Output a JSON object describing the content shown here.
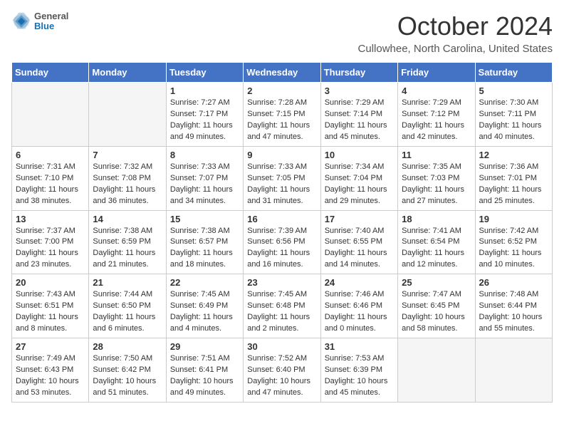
{
  "header": {
    "logo_general": "General",
    "logo_blue": "Blue",
    "title": "October 2024",
    "location": "Cullowhee, North Carolina, United States"
  },
  "days_of_week": [
    "Sunday",
    "Monday",
    "Tuesday",
    "Wednesday",
    "Thursday",
    "Friday",
    "Saturday"
  ],
  "weeks": [
    [
      {
        "day": "",
        "sunrise": "",
        "sunset": "",
        "daylight": ""
      },
      {
        "day": "",
        "sunrise": "",
        "sunset": "",
        "daylight": ""
      },
      {
        "day": "1",
        "sunrise": "Sunrise: 7:27 AM",
        "sunset": "Sunset: 7:17 PM",
        "daylight": "Daylight: 11 hours and 49 minutes."
      },
      {
        "day": "2",
        "sunrise": "Sunrise: 7:28 AM",
        "sunset": "Sunset: 7:15 PM",
        "daylight": "Daylight: 11 hours and 47 minutes."
      },
      {
        "day": "3",
        "sunrise": "Sunrise: 7:29 AM",
        "sunset": "Sunset: 7:14 PM",
        "daylight": "Daylight: 11 hours and 45 minutes."
      },
      {
        "day": "4",
        "sunrise": "Sunrise: 7:29 AM",
        "sunset": "Sunset: 7:12 PM",
        "daylight": "Daylight: 11 hours and 42 minutes."
      },
      {
        "day": "5",
        "sunrise": "Sunrise: 7:30 AM",
        "sunset": "Sunset: 7:11 PM",
        "daylight": "Daylight: 11 hours and 40 minutes."
      }
    ],
    [
      {
        "day": "6",
        "sunrise": "Sunrise: 7:31 AM",
        "sunset": "Sunset: 7:10 PM",
        "daylight": "Daylight: 11 hours and 38 minutes."
      },
      {
        "day": "7",
        "sunrise": "Sunrise: 7:32 AM",
        "sunset": "Sunset: 7:08 PM",
        "daylight": "Daylight: 11 hours and 36 minutes."
      },
      {
        "day": "8",
        "sunrise": "Sunrise: 7:33 AM",
        "sunset": "Sunset: 7:07 PM",
        "daylight": "Daylight: 11 hours and 34 minutes."
      },
      {
        "day": "9",
        "sunrise": "Sunrise: 7:33 AM",
        "sunset": "Sunset: 7:05 PM",
        "daylight": "Daylight: 11 hours and 31 minutes."
      },
      {
        "day": "10",
        "sunrise": "Sunrise: 7:34 AM",
        "sunset": "Sunset: 7:04 PM",
        "daylight": "Daylight: 11 hours and 29 minutes."
      },
      {
        "day": "11",
        "sunrise": "Sunrise: 7:35 AM",
        "sunset": "Sunset: 7:03 PM",
        "daylight": "Daylight: 11 hours and 27 minutes."
      },
      {
        "day": "12",
        "sunrise": "Sunrise: 7:36 AM",
        "sunset": "Sunset: 7:01 PM",
        "daylight": "Daylight: 11 hours and 25 minutes."
      }
    ],
    [
      {
        "day": "13",
        "sunrise": "Sunrise: 7:37 AM",
        "sunset": "Sunset: 7:00 PM",
        "daylight": "Daylight: 11 hours and 23 minutes."
      },
      {
        "day": "14",
        "sunrise": "Sunrise: 7:38 AM",
        "sunset": "Sunset: 6:59 PM",
        "daylight": "Daylight: 11 hours and 21 minutes."
      },
      {
        "day": "15",
        "sunrise": "Sunrise: 7:38 AM",
        "sunset": "Sunset: 6:57 PM",
        "daylight": "Daylight: 11 hours and 18 minutes."
      },
      {
        "day": "16",
        "sunrise": "Sunrise: 7:39 AM",
        "sunset": "Sunset: 6:56 PM",
        "daylight": "Daylight: 11 hours and 16 minutes."
      },
      {
        "day": "17",
        "sunrise": "Sunrise: 7:40 AM",
        "sunset": "Sunset: 6:55 PM",
        "daylight": "Daylight: 11 hours and 14 minutes."
      },
      {
        "day": "18",
        "sunrise": "Sunrise: 7:41 AM",
        "sunset": "Sunset: 6:54 PM",
        "daylight": "Daylight: 11 hours and 12 minutes."
      },
      {
        "day": "19",
        "sunrise": "Sunrise: 7:42 AM",
        "sunset": "Sunset: 6:52 PM",
        "daylight": "Daylight: 11 hours and 10 minutes."
      }
    ],
    [
      {
        "day": "20",
        "sunrise": "Sunrise: 7:43 AM",
        "sunset": "Sunset: 6:51 PM",
        "daylight": "Daylight: 11 hours and 8 minutes."
      },
      {
        "day": "21",
        "sunrise": "Sunrise: 7:44 AM",
        "sunset": "Sunset: 6:50 PM",
        "daylight": "Daylight: 11 hours and 6 minutes."
      },
      {
        "day": "22",
        "sunrise": "Sunrise: 7:45 AM",
        "sunset": "Sunset: 6:49 PM",
        "daylight": "Daylight: 11 hours and 4 minutes."
      },
      {
        "day": "23",
        "sunrise": "Sunrise: 7:45 AM",
        "sunset": "Sunset: 6:48 PM",
        "daylight": "Daylight: 11 hours and 2 minutes."
      },
      {
        "day": "24",
        "sunrise": "Sunrise: 7:46 AM",
        "sunset": "Sunset: 6:46 PM",
        "daylight": "Daylight: 11 hours and 0 minutes."
      },
      {
        "day": "25",
        "sunrise": "Sunrise: 7:47 AM",
        "sunset": "Sunset: 6:45 PM",
        "daylight": "Daylight: 10 hours and 58 minutes."
      },
      {
        "day": "26",
        "sunrise": "Sunrise: 7:48 AM",
        "sunset": "Sunset: 6:44 PM",
        "daylight": "Daylight: 10 hours and 55 minutes."
      }
    ],
    [
      {
        "day": "27",
        "sunrise": "Sunrise: 7:49 AM",
        "sunset": "Sunset: 6:43 PM",
        "daylight": "Daylight: 10 hours and 53 minutes."
      },
      {
        "day": "28",
        "sunrise": "Sunrise: 7:50 AM",
        "sunset": "Sunset: 6:42 PM",
        "daylight": "Daylight: 10 hours and 51 minutes."
      },
      {
        "day": "29",
        "sunrise": "Sunrise: 7:51 AM",
        "sunset": "Sunset: 6:41 PM",
        "daylight": "Daylight: 10 hours and 49 minutes."
      },
      {
        "day": "30",
        "sunrise": "Sunrise: 7:52 AM",
        "sunset": "Sunset: 6:40 PM",
        "daylight": "Daylight: 10 hours and 47 minutes."
      },
      {
        "day": "31",
        "sunrise": "Sunrise: 7:53 AM",
        "sunset": "Sunset: 6:39 PM",
        "daylight": "Daylight: 10 hours and 45 minutes."
      },
      {
        "day": "",
        "sunrise": "",
        "sunset": "",
        "daylight": ""
      },
      {
        "day": "",
        "sunrise": "",
        "sunset": "",
        "daylight": ""
      }
    ]
  ]
}
